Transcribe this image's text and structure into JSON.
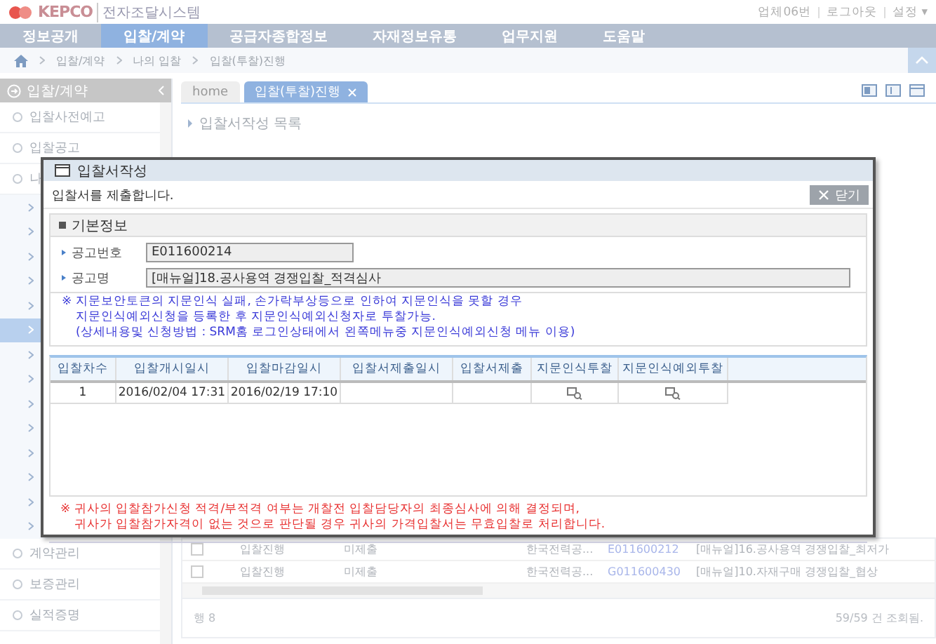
{
  "header": {
    "logo": "KEPCO",
    "system_name": "전자조달시스템",
    "user_links": [
      "업체06번",
      "로그아웃",
      "설정 ▾"
    ]
  },
  "nav": [
    {
      "label": "정보공개",
      "selected": false
    },
    {
      "label": "입찰/계약",
      "selected": true
    },
    {
      "label": "공급자종합정보",
      "selected": false
    },
    {
      "label": "자재정보유통",
      "selected": false
    },
    {
      "label": "업무지원",
      "selected": false
    },
    {
      "label": "도움말",
      "selected": false
    }
  ],
  "breadcrumb": [
    "입찰/계약",
    "나의 입찰",
    "입찰(투찰)진행"
  ],
  "sidebar": {
    "title": "입찰/계약",
    "items_top": [
      "입찰사전예고",
      "입찰공고",
      "나"
    ],
    "sub_items": [
      {
        "selected": false
      },
      {
        "selected": false
      },
      {
        "selected": false
      },
      {
        "selected": false
      },
      {
        "selected": false
      },
      {
        "selected": true
      },
      {
        "selected": false
      },
      {
        "selected": false
      },
      {
        "selected": false
      },
      {
        "selected": false
      },
      {
        "selected": false
      },
      {
        "selected": false
      },
      {
        "selected": false
      },
      {
        "selected": false
      }
    ],
    "items_bottom": [
      "계약관리",
      "보증관리",
      "실적증명"
    ]
  },
  "tabs": [
    {
      "label": "home",
      "selected": false,
      "closable": false
    },
    {
      "label": "입찰(투찰)진행",
      "selected": true,
      "closable": true
    }
  ],
  "content_title": "입찰서작성 목록",
  "list_rows": [
    {
      "checked": false,
      "cells": [
        "입찰진행",
        "미제출",
        "",
        "한국전력공...",
        "E011600212",
        "[매뉴얼]16.공사용역 경쟁입찰_최저가"
      ]
    },
    {
      "checked": false,
      "cells": [
        "입찰진행",
        "미제출",
        "",
        "한국전력공...",
        "G011600430",
        "[매뉴얼]10.자재구매 경쟁입찰_협상"
      ]
    }
  ],
  "list_footer": {
    "row_count": "행 8",
    "result": "59/59 건 조회됨."
  },
  "dialog": {
    "title": "입찰서작성",
    "message": "입찰서를 제출합니다.",
    "close_button": "닫기",
    "section_title": "기본정보",
    "fields": [
      {
        "label": "공고번호",
        "value": "E011600214",
        "wide": false
      },
      {
        "label": "공고명",
        "value": "[매뉴얼]18.공사용역 경쟁입찰_적격심사",
        "wide": true
      }
    ],
    "notice": [
      "※ 지문보안토큰의 지문인식 실패, 손가락부상등으로 인하여 지문인식을 못할 경우",
      "지문인식예외신청을 등록한 후 지문인식예외신청자로 투찰가능.",
      "(상세내용및 신청방법 : SRM홈 로그인상태에서 왼쪽메뉴중 지문인식예외신청 메뉴 이용)"
    ],
    "table": {
      "columns": [
        "입찰차수",
        "입찰개시일시",
        "입찰마감일시",
        "입찰서제출일시",
        "입찰서제출",
        "지문인식투찰",
        "지문인식예외투찰"
      ],
      "rows": [
        [
          {
            "kind": "text",
            "text": "1"
          },
          {
            "kind": "text",
            "text": "2016/02/04 17:31"
          },
          {
            "kind": "text",
            "text": "2016/02/19 17:10"
          },
          {
            "kind": "empty"
          },
          {
            "kind": "empty"
          },
          {
            "kind": "icon"
          },
          {
            "kind": "icon"
          }
        ]
      ]
    },
    "warning": [
      "※ 귀사의 입찰참가신청 적격/부적격 여부는 개찰전 입찰담당자의 최종심사에 의해 결정되며,",
      "귀사가 입찰참가자격이 없는 것으로 판단될 경우 귀사의 가격입찰서는 무효입찰로 처리합니다."
    ]
  }
}
